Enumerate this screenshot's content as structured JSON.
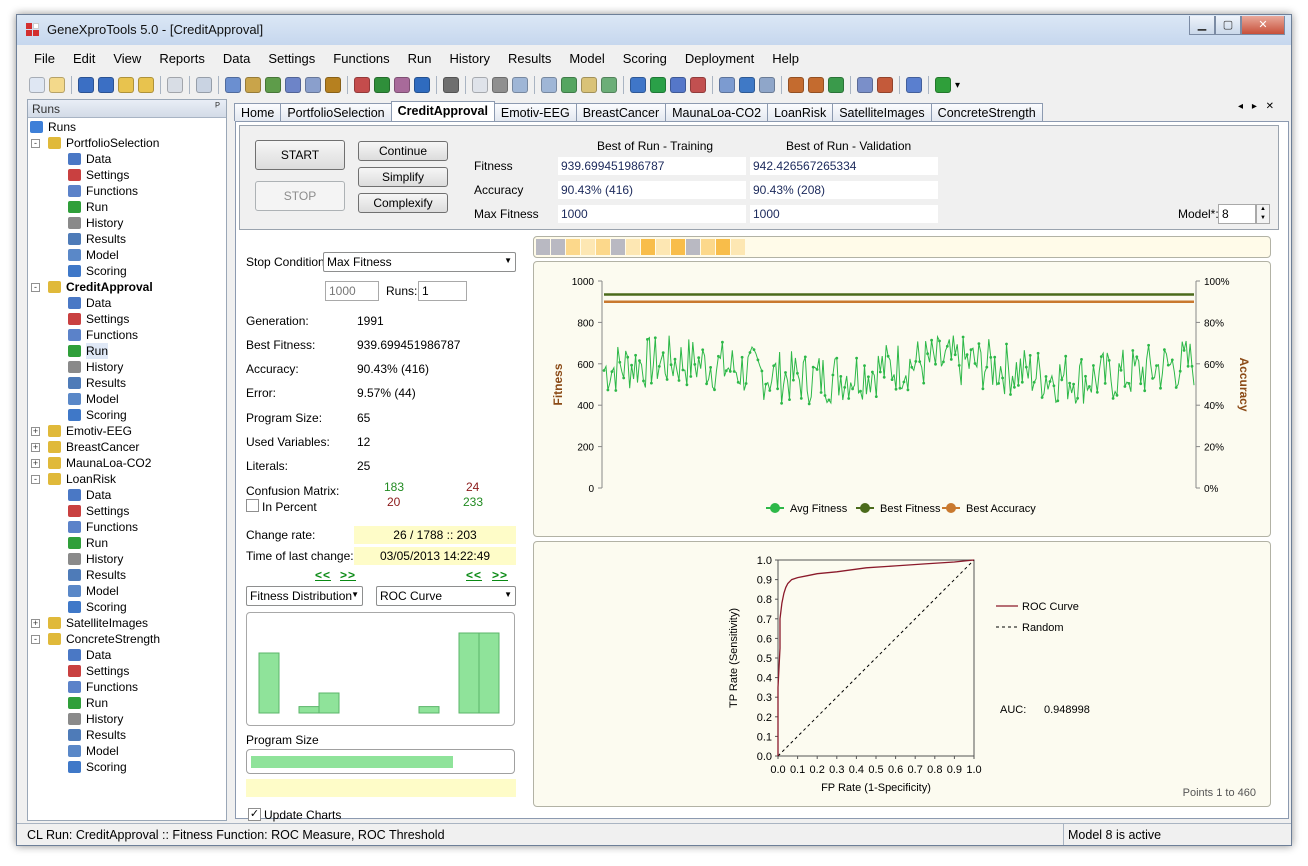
{
  "window": {
    "title": "GeneXproTools 5.0 - [CreditApproval]",
    "buttons": [
      "▁",
      "▢",
      "✕"
    ]
  },
  "menu": [
    "File",
    "Edit",
    "View",
    "Reports",
    "Data",
    "Settings",
    "Functions",
    "Run",
    "History",
    "Results",
    "Model",
    "Scoring",
    "Deployment",
    "Help"
  ],
  "toolbar": {
    "more": "▾"
  },
  "runs_panel": {
    "title": "Runs",
    "pin": "ᴾ",
    "items": [
      {
        "label": "Runs",
        "level": 0,
        "icon": "runs-icon",
        "color": "#3d7fd8"
      },
      {
        "label": "PortfolioSelection",
        "level": 1,
        "expand": "-",
        "icon": "folder-icon",
        "color": "#e0b93a"
      },
      {
        "label": "Data",
        "level": 2,
        "icon": "data-icon",
        "color": "#4a78c5"
      },
      {
        "label": "Settings",
        "level": 2,
        "icon": "settings-icon",
        "color": "#c94040"
      },
      {
        "label": "Functions",
        "level": 2,
        "icon": "functions-icon",
        "color": "#5b82c9"
      },
      {
        "label": "Run",
        "level": 2,
        "icon": "run-icon",
        "color": "#2f9f3a"
      },
      {
        "label": "History",
        "level": 2,
        "icon": "history-icon",
        "color": "#8a8a8a"
      },
      {
        "label": "Results",
        "level": 2,
        "icon": "results-icon",
        "color": "#4e7bb8"
      },
      {
        "label": "Model",
        "level": 2,
        "icon": "model-icon",
        "color": "#5a88c8"
      },
      {
        "label": "Scoring",
        "level": 2,
        "icon": "scoring-icon",
        "color": "#3f78c8"
      },
      {
        "label": "CreditApproval",
        "level": 1,
        "expand": "-",
        "icon": "folder-icon",
        "color": "#e0b93a",
        "bold": true
      },
      {
        "label": "Data",
        "level": 2,
        "icon": "data-icon",
        "color": "#4a78c5"
      },
      {
        "label": "Settings",
        "level": 2,
        "icon": "settings-icon",
        "color": "#c94040"
      },
      {
        "label": "Functions",
        "level": 2,
        "icon": "functions-icon",
        "color": "#5b82c9"
      },
      {
        "label": "Run",
        "level": 2,
        "icon": "run-icon",
        "color": "#2f9f3a",
        "selected": true
      },
      {
        "label": "History",
        "level": 2,
        "icon": "history-icon",
        "color": "#8a8a8a"
      },
      {
        "label": "Results",
        "level": 2,
        "icon": "results-icon",
        "color": "#4e7bb8"
      },
      {
        "label": "Model",
        "level": 2,
        "icon": "model-icon",
        "color": "#5a88c8"
      },
      {
        "label": "Scoring",
        "level": 2,
        "icon": "scoring-icon",
        "color": "#3f78c8"
      },
      {
        "label": "Emotiv-EEG",
        "level": 1,
        "expand": "+",
        "icon": "folder-icon",
        "color": "#e0b93a"
      },
      {
        "label": "BreastCancer",
        "level": 1,
        "expand": "+",
        "icon": "folder-icon",
        "color": "#e0b93a"
      },
      {
        "label": "MaunaLoa-CO2",
        "level": 1,
        "expand": "+",
        "icon": "folder-icon",
        "color": "#e0b93a"
      },
      {
        "label": "LoanRisk",
        "level": 1,
        "expand": "-",
        "icon": "folder-icon",
        "color": "#e0b93a"
      },
      {
        "label": "Data",
        "level": 2,
        "icon": "data-icon",
        "color": "#4a78c5"
      },
      {
        "label": "Settings",
        "level": 2,
        "icon": "settings-icon",
        "color": "#c94040"
      },
      {
        "label": "Functions",
        "level": 2,
        "icon": "functions-icon",
        "color": "#5b82c9"
      },
      {
        "label": "Run",
        "level": 2,
        "icon": "run-icon",
        "color": "#2f9f3a"
      },
      {
        "label": "History",
        "level": 2,
        "icon": "history-icon",
        "color": "#8a8a8a"
      },
      {
        "label": "Results",
        "level": 2,
        "icon": "results-icon",
        "color": "#4e7bb8"
      },
      {
        "label": "Model",
        "level": 2,
        "icon": "model-icon",
        "color": "#5a88c8"
      },
      {
        "label": "Scoring",
        "level": 2,
        "icon": "scoring-icon",
        "color": "#3f78c8"
      },
      {
        "label": "SatelliteImages",
        "level": 1,
        "expand": "+",
        "icon": "folder-icon",
        "color": "#e0b93a"
      },
      {
        "label": "ConcreteStrength",
        "level": 1,
        "expand": "-",
        "icon": "folder-icon",
        "color": "#e0b93a"
      },
      {
        "label": "Data",
        "level": 2,
        "icon": "data-icon",
        "color": "#4a78c5"
      },
      {
        "label": "Settings",
        "level": 2,
        "icon": "settings-icon",
        "color": "#c94040"
      },
      {
        "label": "Functions",
        "level": 2,
        "icon": "functions-icon",
        "color": "#5b82c9"
      },
      {
        "label": "Run",
        "level": 2,
        "icon": "run-icon",
        "color": "#2f9f3a"
      },
      {
        "label": "History",
        "level": 2,
        "icon": "history-icon",
        "color": "#8a8a8a"
      },
      {
        "label": "Results",
        "level": 2,
        "icon": "results-icon",
        "color": "#4e7bb8"
      },
      {
        "label": "Model",
        "level": 2,
        "icon": "model-icon",
        "color": "#5a88c8"
      },
      {
        "label": "Scoring",
        "level": 2,
        "icon": "scoring-icon",
        "color": "#3f78c8"
      }
    ]
  },
  "tabs": [
    {
      "label": "Home"
    },
    {
      "label": "PortfolioSelection"
    },
    {
      "label": "CreditApproval",
      "active": true
    },
    {
      "label": "Emotiv-EEG"
    },
    {
      "label": "BreastCancer"
    },
    {
      "label": "MaunaLoa-CO2"
    },
    {
      "label": "LoanRisk"
    },
    {
      "label": "SatelliteImages"
    },
    {
      "label": "ConcreteStrength"
    }
  ],
  "tab_arrows": "◂ ▸ ✕",
  "controls": {
    "start": "START",
    "stop": "STOP",
    "continue": "Continue",
    "simplify": "Simplify",
    "complexify": "Complexify",
    "col_training": "Best of Run - Training",
    "col_validation": "Best of Run - Validation",
    "rows": [
      {
        "label": "Fitness",
        "training": "939.699451986787",
        "validation": "942.426567265334"
      },
      {
        "label": "Accuracy",
        "training": "90.43% (416)",
        "validation": "90.43% (208)"
      },
      {
        "label": "Max Fitness",
        "training": "1000",
        "validation": "1000"
      }
    ],
    "model_label": "Model*:",
    "model_value": "8",
    "spin_up": "▲",
    "spin_down": "▼"
  },
  "stats": {
    "stop_condition_label": "Stop Condition:",
    "stop_condition_value": "Max Fitness",
    "stop_value": "1000",
    "runs_label": "Runs:",
    "runs_value": "1",
    "generation_label": "Generation:",
    "generation_value": "1991",
    "best_fitness_label": "Best Fitness:",
    "best_fitness_value": "939.699451986787",
    "accuracy_label": "Accuracy:",
    "accuracy_value": "90.43% (416)",
    "error_label": "Error:",
    "error_value": "9.57% (44)",
    "program_size_label": "Program Size:",
    "program_size_value": "65",
    "used_variables_label": "Used Variables:",
    "used_variables_value": "12",
    "literals_label": "Literals:",
    "literals_value": "25",
    "confusion_label": "Confusion Matrix:",
    "confusion": {
      "tp": "183",
      "fp": "24",
      "fn": "20",
      "tn": "233"
    },
    "in_percent_label": "In Percent",
    "change_rate_label": "Change rate:",
    "change_rate_value": "26 / 1788 :: 203",
    "last_change_label": "Time of last change:",
    "last_change_value": "03/05/2013 14:22:49",
    "nav_prev": "<<",
    "nav_next": ">>",
    "dist_combo": "Fitness Distribution",
    "roc_combo": "ROC Curve",
    "program_size_chart_label": "Program Size",
    "program_size_fill": 0.78,
    "update_charts_label": "Update Charts",
    "check_mark": "✓",
    "dist_values": [
      0.75,
      0,
      0.08,
      0.25,
      0,
      0,
      0,
      0,
      0.08,
      0,
      1.0,
      1.0
    ]
  },
  "population_strip": [
    "#b9b9c2",
    "#b9b9c2",
    "#fcd88b",
    "#fde7b3",
    "#fcd88b",
    "#b9b9c2",
    "#fde7b3",
    "#f8bd4a",
    "#fde7b3",
    "#f8bd4a",
    "#b9b9c2",
    "#fcd88b",
    "#f8bd4a",
    "#fde7b3"
  ],
  "chart_data": [
    {
      "type": "line",
      "ylabel": "Fitness",
      "y2label": "Accuracy",
      "ylim": [
        0,
        1000
      ],
      "y2lim": [
        0,
        100
      ],
      "yticks": [
        "0",
        "200",
        "400",
        "600",
        "800",
        "1000"
      ],
      "y2ticks": [
        "0%",
        "20%",
        "40%",
        "60%",
        "80%",
        "100%"
      ],
      "legend": [
        "Avg Fitness",
        "Best Fitness",
        "Best Accuracy"
      ],
      "legend_position": "bottom",
      "series": [
        {
          "name": "Avg Fitness",
          "color": "#2db848",
          "approx_mean": 570,
          "approx_range": [
            300,
            760
          ],
          "points": 460
        },
        {
          "name": "Best Fitness",
          "color": "#4b6b1b",
          "values_constant": 935
        },
        {
          "name": "Best Accuracy",
          "color": "#c9792f",
          "values_constant": 90
        }
      ]
    },
    {
      "type": "line",
      "xlabel": "FP Rate (1-Specificity)",
      "ylabel": "TP Rate (Sensitivity)",
      "xlim": [
        0,
        1
      ],
      "ylim": [
        0,
        1
      ],
      "xticks": [
        "0.0",
        "0.1",
        "0.2",
        "0.3",
        "0.4",
        "0.5",
        "0.6",
        "0.7",
        "0.8",
        "0.9",
        "1.0"
      ],
      "yticks": [
        "0.0",
        "0.1",
        "0.2",
        "0.3",
        "0.4",
        "0.5",
        "0.6",
        "0.7",
        "0.8",
        "0.9",
        "1.0"
      ],
      "legend": [
        "ROC Curve",
        "Random"
      ],
      "auc_label": "AUC:",
      "auc_value": "0.948998",
      "points_label": "Points 1 to 460",
      "series": [
        {
          "name": "ROC Curve",
          "color": "#8b1a2b",
          "x": [
            0,
            0,
            0.01,
            0.01,
            0.02,
            0.03,
            0.04,
            0.05,
            0.07,
            0.1,
            0.15,
            0.2,
            0.3,
            0.45,
            0.6,
            0.75,
            0.9,
            1.0
          ],
          "y": [
            0,
            0.35,
            0.55,
            0.7,
            0.78,
            0.83,
            0.86,
            0.88,
            0.9,
            0.91,
            0.92,
            0.93,
            0.94,
            0.96,
            0.97,
            0.98,
            0.99,
            1.0
          ]
        },
        {
          "name": "Random",
          "color": "#000000",
          "x": [
            0,
            1
          ],
          "y": [
            0,
            1
          ]
        }
      ]
    }
  ],
  "status": {
    "left": "CL Run: CreditApproval :: Fitness Function: ROC Measure, ROC Threshold",
    "right": "Model 8 is active"
  }
}
